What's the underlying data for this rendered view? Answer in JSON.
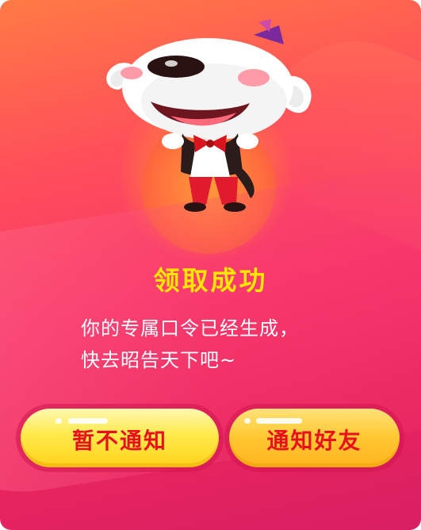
{
  "dialog": {
    "title": "领取成功",
    "message_line1": "你的专属口令已经生成，",
    "message_line2": "快去昭告天下吧~"
  },
  "buttons": {
    "dismiss_label": "暂不通知",
    "notify_label": "通知好友"
  },
  "colors": {
    "title": "#ffe600",
    "button_text": "#e8101e",
    "background_top": "#ff7a45",
    "background_bottom": "#d81f63"
  },
  "icons": {
    "mascot": "joy-dog-mascot-icon"
  }
}
